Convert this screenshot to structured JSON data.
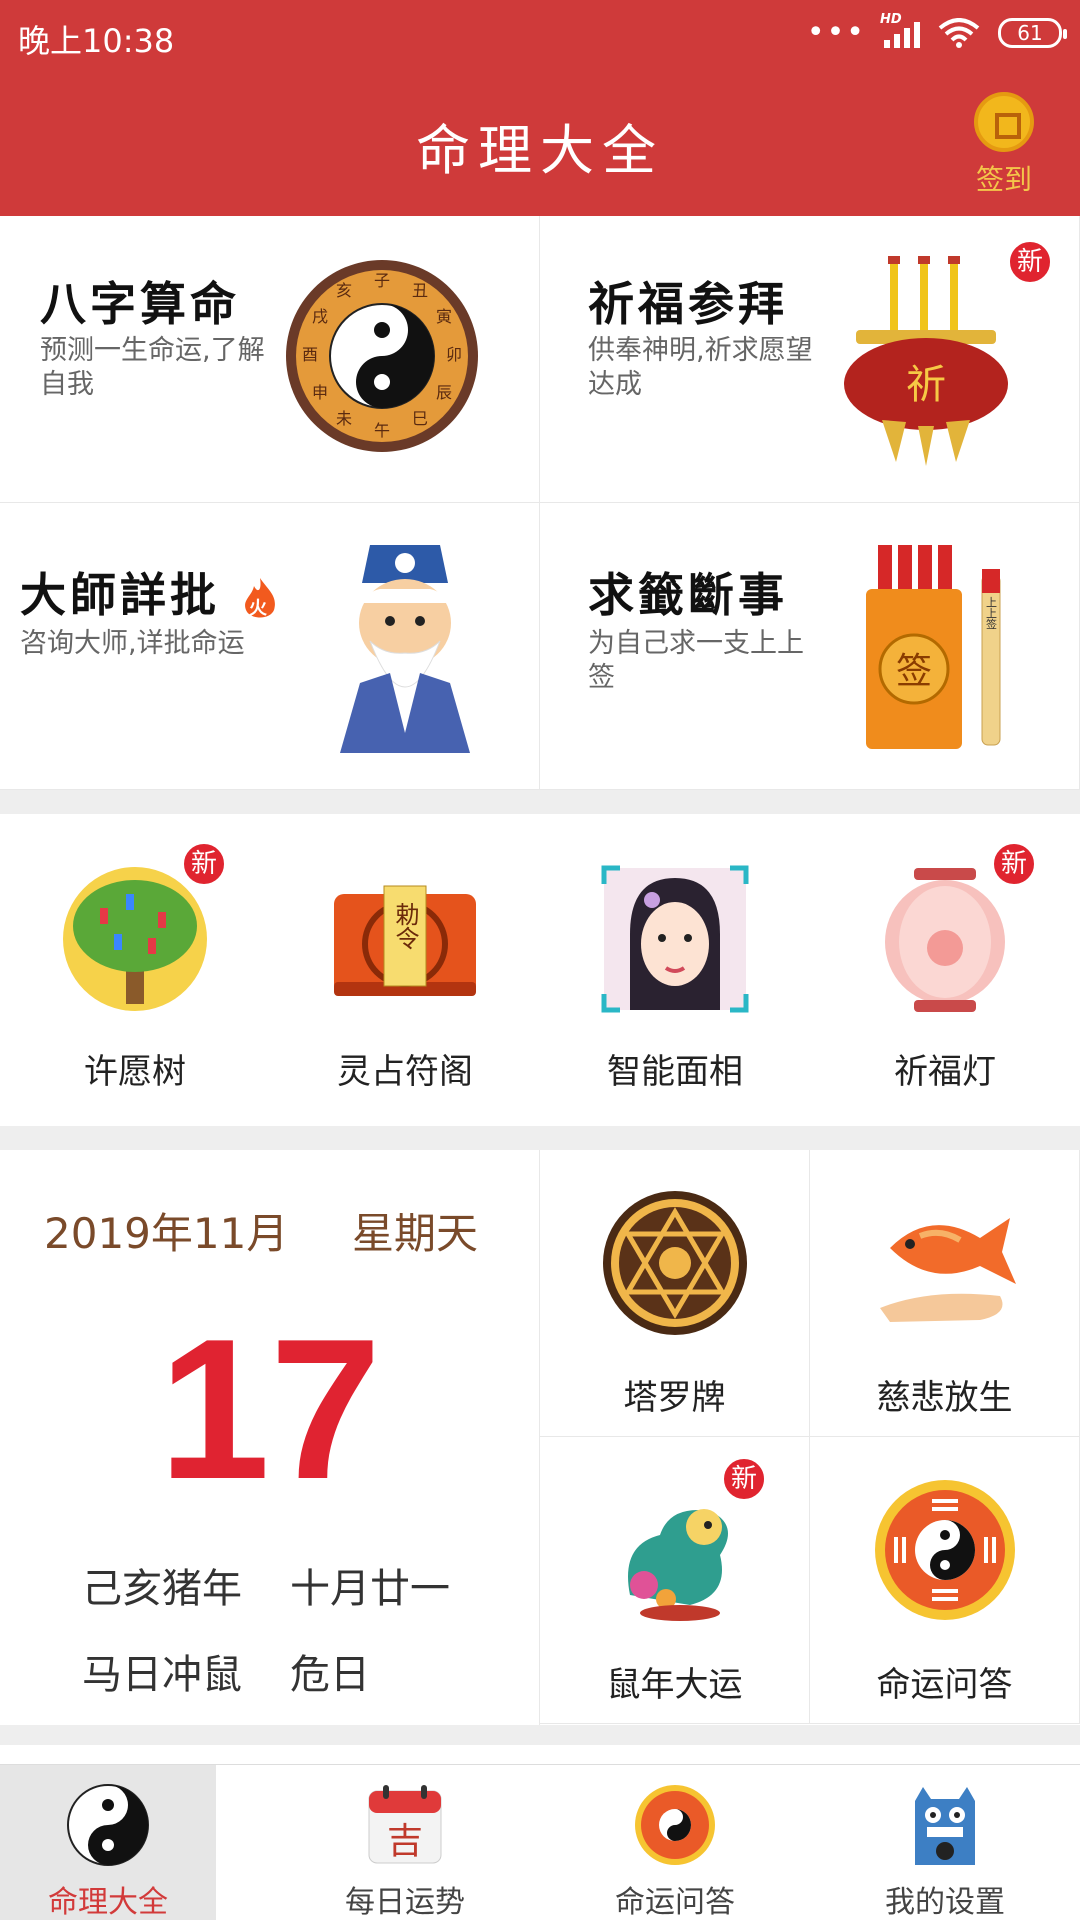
{
  "status_bar": {
    "time": "晚上10:38",
    "battery": "61",
    "network": "HD"
  },
  "header": {
    "title": "命理大全",
    "checkin_label": "签到"
  },
  "features": [
    {
      "title": "八字算命",
      "desc": "预测一生命运,了解自我",
      "badge": ""
    },
    {
      "title": "祈福参拜",
      "desc": "供奉神明,祈求愿望达成",
      "badge": "新"
    },
    {
      "title": "大師詳批",
      "desc": "咨询大师,详批命运",
      "badge": ""
    },
    {
      "title": "求籤斷事",
      "desc": "为自己求一支上上签",
      "badge": ""
    }
  ],
  "feature_art": {
    "bagua_chars": [
      "子",
      "丑",
      "寅",
      "卯",
      "辰",
      "巳",
      "午",
      "未",
      "申",
      "酉",
      "戌",
      "亥"
    ],
    "censer_char": "祈",
    "fire_char": "火",
    "lot_tube_char": "签",
    "lot_stick_text": "上上签"
  },
  "icon_row": [
    {
      "label": "许愿树",
      "badge": "新",
      "icon": "wish-tree-icon"
    },
    {
      "label": "灵占符阁",
      "badge": "",
      "icon": "talisman-icon"
    },
    {
      "label": "智能面相",
      "badge": "",
      "icon": "face-reading-icon"
    },
    {
      "label": "祈福灯",
      "badge": "新",
      "icon": "lantern-icon"
    }
  ],
  "icon_art": {
    "talisman_text": "勅令"
  },
  "calendar": {
    "month": "2019年11月",
    "weekday": "星期天",
    "day": "17",
    "lunar_year": "己亥猪年",
    "lunar_date": "十月廿一",
    "clash": "马日冲鼠",
    "day_type": "危日"
  },
  "tools": [
    {
      "label": "塔罗牌",
      "badge": "",
      "icon": "tarot-icon"
    },
    {
      "label": "慈悲放生",
      "badge": "",
      "icon": "fish-release-icon"
    },
    {
      "label": "鼠年大运",
      "badge": "新",
      "icon": "rat-year-icon"
    },
    {
      "label": "命运问答",
      "badge": "",
      "icon": "bagua-icon"
    }
  ],
  "tabs": [
    {
      "label": "命理大全",
      "active": true,
      "icon": "yin-yang-icon"
    },
    {
      "label": "每日运势",
      "active": false,
      "icon": "calendar-icon"
    },
    {
      "label": "命运问答",
      "active": false,
      "icon": "bagua-icon"
    },
    {
      "label": "我的设置",
      "active": false,
      "icon": "monster-icon"
    }
  ],
  "tab_art": {
    "calendar_char": "吉"
  },
  "colors": {
    "primary": "#cf3a3a",
    "accent_gold": "#f2b71c",
    "day_red": "#e02331",
    "month_brown": "#7a4a2a"
  }
}
